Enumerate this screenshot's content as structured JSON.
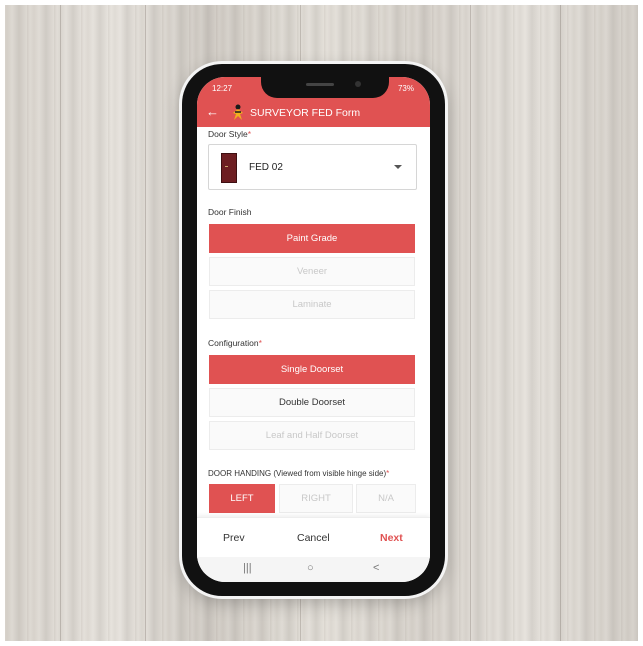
{
  "status_bar": {
    "time": "12:27",
    "right": "73%"
  },
  "app_bar": {
    "back_icon": "←",
    "logo_icon": "surveyor-logo-icon",
    "title": "SURVEYOR FED Form"
  },
  "door_style": {
    "label": "Door Style",
    "required": "*",
    "value": "FED 02"
  },
  "door_finish": {
    "label": "Door Finish",
    "options": [
      {
        "label": "Paint Grade",
        "state": "selected"
      },
      {
        "label": "Veneer",
        "state": "disabled"
      },
      {
        "label": "Laminate",
        "state": "disabled"
      }
    ]
  },
  "configuration": {
    "label": "Configuration",
    "required": "*",
    "options": [
      {
        "label": "Single Doorset",
        "state": "selected"
      },
      {
        "label": "Double Doorset",
        "state": "enabled"
      },
      {
        "label": "Leaf and Half Doorset",
        "state": "disabled"
      }
    ]
  },
  "door_handing": {
    "label": "DOOR HANDING (Viewed from visible hinge side)",
    "required": "*",
    "options": [
      {
        "label": "LEFT",
        "state": "selected"
      },
      {
        "label": "RIGHT",
        "state": "disabled"
      },
      {
        "label": "N/A",
        "state": "disabled"
      }
    ]
  },
  "footer": {
    "prev": "Prev",
    "cancel": "Cancel",
    "next": "Next"
  },
  "system_nav": {
    "recents": "|||",
    "home": "○",
    "back": "<"
  },
  "colors": {
    "accent": "#e05252",
    "disabled_text": "#c8c8c8",
    "door_thumb": "#6d1e22"
  }
}
